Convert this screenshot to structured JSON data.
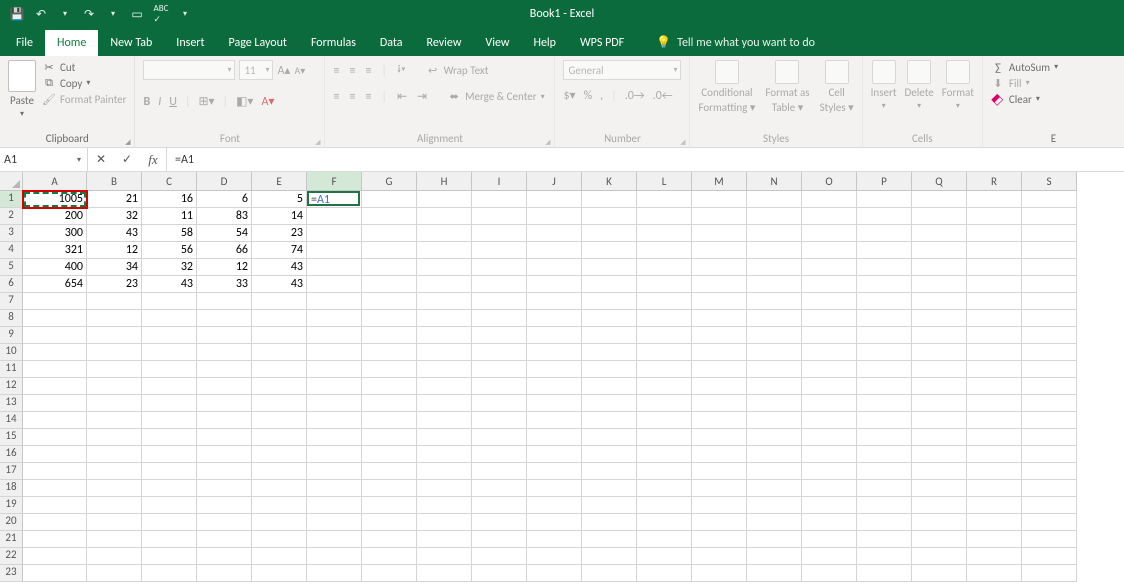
{
  "app": {
    "title": "Book1 - Excel"
  },
  "qat": {
    "save": "save-icon",
    "undo": "undo-icon",
    "redo": "redo-icon",
    "touch": "touch-mode-icon",
    "spell": "spelling-icon"
  },
  "tabs": {
    "file": "File",
    "home": "Home",
    "newtab": "New Tab",
    "insert": "Insert",
    "pagelayout": "Page Layout",
    "formulas": "Formulas",
    "data": "Data",
    "review": "Review",
    "view": "View",
    "help": "Help",
    "wpspdf": "WPS PDF",
    "tellme": "Tell me what you want to do"
  },
  "ribbon": {
    "clipboard": {
      "label": "Clipboard",
      "paste": "Paste",
      "cut": "Cut",
      "copy": "Copy",
      "format_painter": "Format Painter"
    },
    "font": {
      "label": "Font",
      "size": "11",
      "bold": "B",
      "italic": "I",
      "underline": "U"
    },
    "alignment": {
      "label": "Alignment",
      "wrap": "Wrap Text",
      "merge": "Merge & Center"
    },
    "number": {
      "label": "Number",
      "format": "General"
    },
    "styles": {
      "label": "Styles",
      "cond": "Conditional",
      "cond2": "Formatting",
      "fmt": "Format as",
      "fmt2": "Table",
      "cell": "Cell",
      "cell2": "Styles"
    },
    "cells": {
      "label": "Cells",
      "insert": "Insert",
      "delete": "Delete",
      "format": "Format"
    },
    "editing": {
      "label": "E",
      "autosum": "AutoSum",
      "fill": "Fill",
      "clear": "Clear"
    }
  },
  "formula_bar": {
    "namebox": "A1",
    "formula_prefix": "=",
    "formula_ref": "A1"
  },
  "grid": {
    "columns": [
      "A",
      "B",
      "C",
      "D",
      "E",
      "F",
      "G",
      "H",
      "I",
      "J",
      "K",
      "L",
      "M",
      "N",
      "O",
      "P",
      "Q",
      "R",
      "S"
    ],
    "row_count": 23,
    "data": [
      [
        "1005",
        "21",
        "16",
        "6",
        "5"
      ],
      [
        "200",
        "32",
        "11",
        "83",
        "14"
      ],
      [
        "300",
        "43",
        "58",
        "54",
        "23"
      ],
      [
        "321",
        "12",
        "56",
        "66",
        "74"
      ],
      [
        "400",
        "34",
        "32",
        "12",
        "43"
      ],
      [
        "654",
        "23",
        "43",
        "33",
        "43"
      ]
    ],
    "edit_cell_display_prefix": "=",
    "edit_cell_display_ref": "A1",
    "active_row": 1,
    "active_col": "F",
    "referenced_cell": "A1"
  }
}
